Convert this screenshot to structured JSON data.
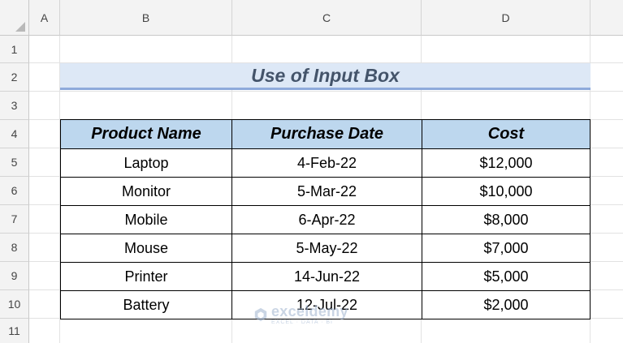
{
  "columns": [
    "A",
    "B",
    "C",
    "D"
  ],
  "rows": [
    "1",
    "2",
    "3",
    "4",
    "5",
    "6",
    "7",
    "8",
    "9",
    "10",
    "11"
  ],
  "title": "Use of Input Box",
  "table": {
    "headers": [
      "Product Name",
      "Purchase Date",
      "Cost"
    ],
    "rows": [
      [
        "Laptop",
        "4-Feb-22",
        "$12,000"
      ],
      [
        "Monitor",
        "5-Mar-22",
        "$10,000"
      ],
      [
        "Mobile",
        "6-Apr-22",
        "$8,000"
      ],
      [
        "Mouse",
        "5-May-22",
        "$7,000"
      ],
      [
        "Printer",
        "14-Jun-22",
        "$5,000"
      ],
      [
        "Battery",
        "12-Jul-22",
        "$2,000"
      ]
    ]
  },
  "watermark": {
    "name": "exceldemy",
    "sub": "EXCEL · DATA · BI",
    "icon": "exceldemy-logo-icon"
  },
  "colors": {
    "header_fill": "#bdd7ee",
    "title_fill": "#dde8f6",
    "title_text": "#44546a",
    "title_underline": "#8eaadb"
  }
}
